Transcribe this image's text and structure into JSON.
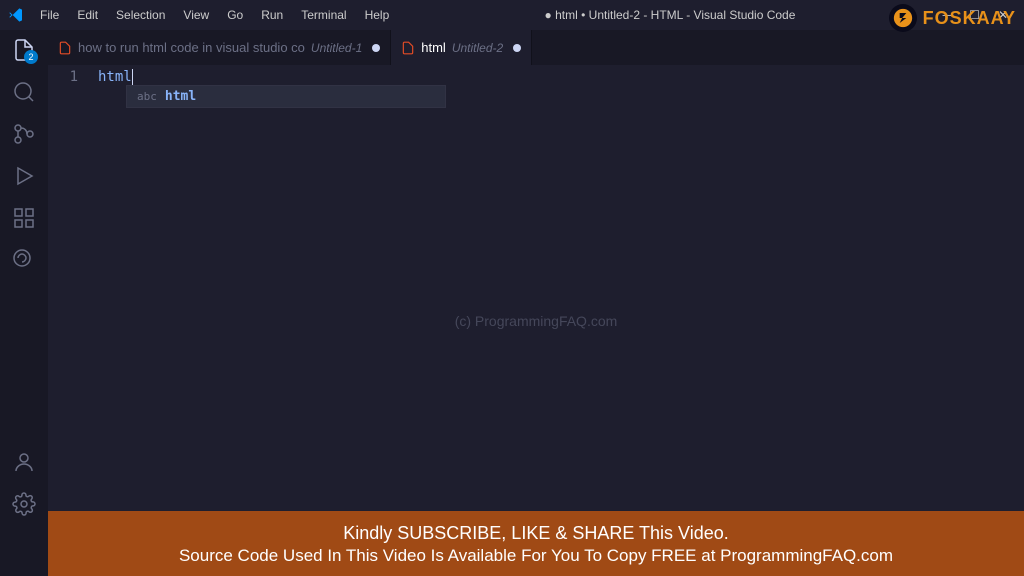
{
  "title_bar": {
    "menu": [
      "File",
      "Edit",
      "Selection",
      "View",
      "Go",
      "Run",
      "Terminal",
      "Help"
    ],
    "window_title": "● html • Untitled-2 - HTML - Visual Studio Code"
  },
  "brand": {
    "text": "FOSKAAY"
  },
  "activity_bar": {
    "explorer_badge": "2"
  },
  "tabs": [
    {
      "icon": "html",
      "label": "how to run html code in visual studio co",
      "sublabel": "Untitled-1",
      "dirty": true,
      "active": false
    },
    {
      "icon": "html",
      "label": "html",
      "sublabel": "Untitled-2",
      "dirty": true,
      "active": true
    }
  ],
  "editor": {
    "line_number": "1",
    "code_text": "html",
    "autocomplete": {
      "kind": "abc",
      "label": "html"
    }
  },
  "watermark": "(c) ProgrammingFAQ.com",
  "banner": {
    "line1": "Kindly SUBSCRIBE, LIKE & SHARE This Video.",
    "line2": "Source Code Used In This Video Is Available For You To Copy  FREE at  ProgrammingFAQ.com"
  }
}
